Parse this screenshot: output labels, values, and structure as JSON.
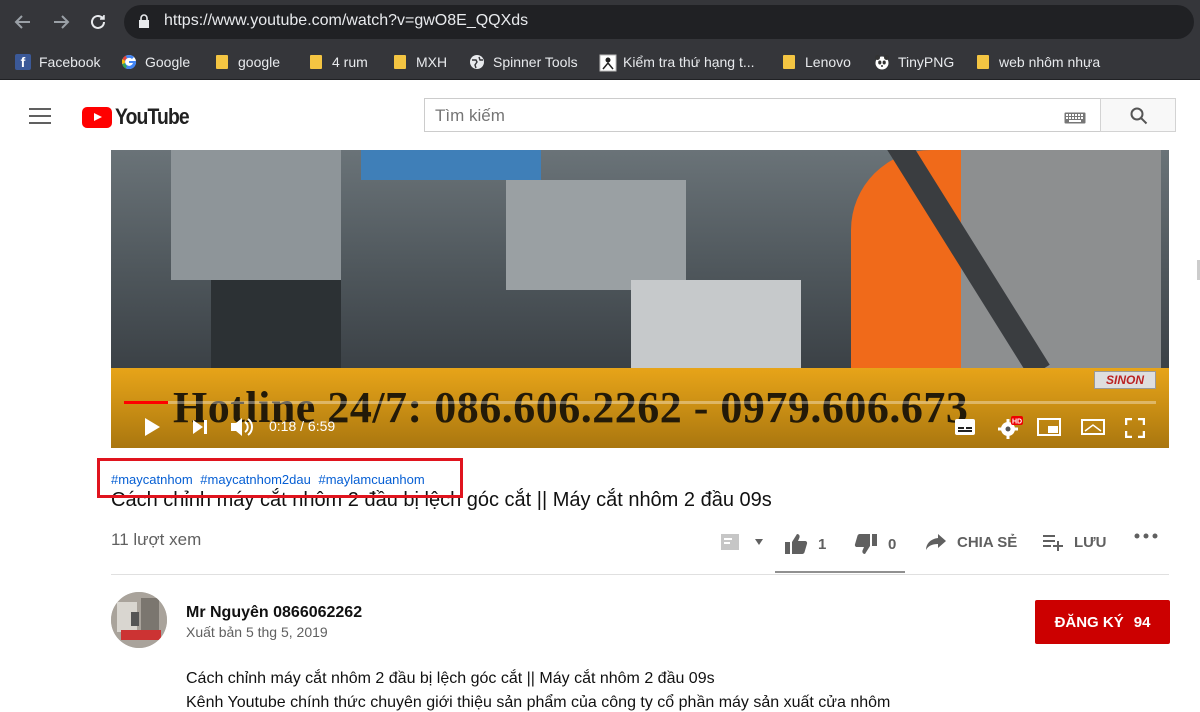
{
  "browser": {
    "url": "https://www.youtube.com/watch?v=gwO8E_QQXds",
    "bookmarks": [
      {
        "label": "Facebook",
        "icon": "facebook-icon"
      },
      {
        "label": "Google",
        "icon": "google-icon"
      },
      {
        "label": "google",
        "icon": "folder-icon"
      },
      {
        "label": "4 rum",
        "icon": "folder-icon"
      },
      {
        "label": "MXH",
        "icon": "folder-icon"
      },
      {
        "label": "Spinner Tools",
        "icon": "globe-icon"
      },
      {
        "label": "Kiểm tra thứ hạng t...",
        "icon": "page-icon"
      },
      {
        "label": "Lenovo",
        "icon": "folder-icon"
      },
      {
        "label": "TinyPNG",
        "icon": "panda-icon"
      },
      {
        "label": "web nhôm nhựa",
        "icon": "folder-icon"
      }
    ]
  },
  "header": {
    "logo_text": "YouTube",
    "search_placeholder": "Tìm kiếm"
  },
  "video": {
    "overlay_text": "Hotline 24/7: 086.606.2262 - 0979.606.673",
    "watermark": "SINON",
    "current_time": "0:18",
    "duration": "6:59",
    "time_display": "0:18 / 6:59",
    "progress_fraction": 0.043,
    "hd_badge": "HD"
  },
  "info": {
    "hashtags": [
      "#maycatnhom",
      "#maycatnhom2dau",
      "#maylamcuanhom"
    ],
    "title": "Cách chỉnh máy cắt nhôm 2 đầu bị lệch góc cắt || Máy cắt nhôm 2 đầu 09s",
    "views": "11 lượt xem",
    "likes": "1",
    "dislikes": "0",
    "share_label": "CHIA SẺ",
    "save_label": "LƯU"
  },
  "channel": {
    "name": "Mr Nguyên 0866062262",
    "published": "Xuất bản 5 thg 5, 2019",
    "subscribe_label": "ĐĂNG KÝ",
    "subscriber_count": "94"
  },
  "description": {
    "line1": "Cách chỉnh máy cắt nhôm 2 đầu bị lệch góc cắt || Máy cắt nhôm 2 đầu 09s",
    "line2": "Kênh Youtube chính thức chuyên giới thiệu sản phẩm của công ty cổ phần máy sản xuất cửa nhôm"
  },
  "colors": {
    "chrome_dark": "#35363a",
    "yt_red": "#ff0000",
    "subscribe_red": "#cc0000",
    "hashtag_blue": "#065fd4",
    "highlight_box": "#e0141e"
  }
}
